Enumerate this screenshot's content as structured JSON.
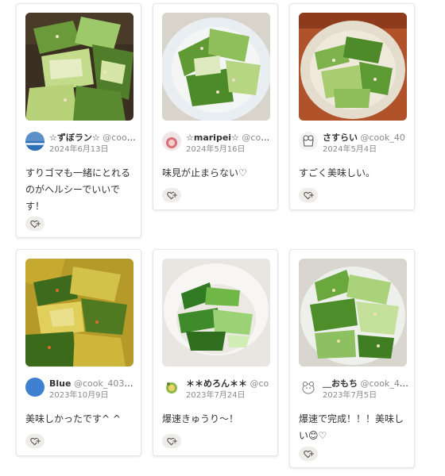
{
  "cards": [
    {
      "name": "☆ずぼラン☆",
      "handle": "@cook_",
      "date": "2024年6月13日",
      "comment": "すりゴマも一緒にとれるのがヘルシーでいいです！",
      "like_icon": "heart-plus-icon"
    },
    {
      "name": "☆maripei☆",
      "handle": "@cook_",
      "date": "2024年5月16日",
      "comment": "味見が止まらない♡",
      "like_icon": "heart-plus-icon"
    },
    {
      "name": "さすらい",
      "handle": "@cook_40",
      "date": "2024年5月4日",
      "comment": "すごく美味しい。",
      "like_icon": "heart-plus-icon"
    },
    {
      "name": "Blue",
      "handle": "@cook_403482",
      "date": "2023年10月9日",
      "comment": "美味しかったです^ ^",
      "like_icon": "heart-plus-icon"
    },
    {
      "name": "＊＊めろん＊＊",
      "handle": "@co",
      "date": "2023年7月24日",
      "comment": "爆速きゅうり〜！",
      "like_icon": "heart-plus-icon"
    },
    {
      "name": "＿おもち",
      "handle": "@cook_412",
      "date": "2023年7月5日",
      "comment": "爆速で完成！！！美味しい😊♡",
      "like_icon": "heart-plus-icon"
    }
  ]
}
